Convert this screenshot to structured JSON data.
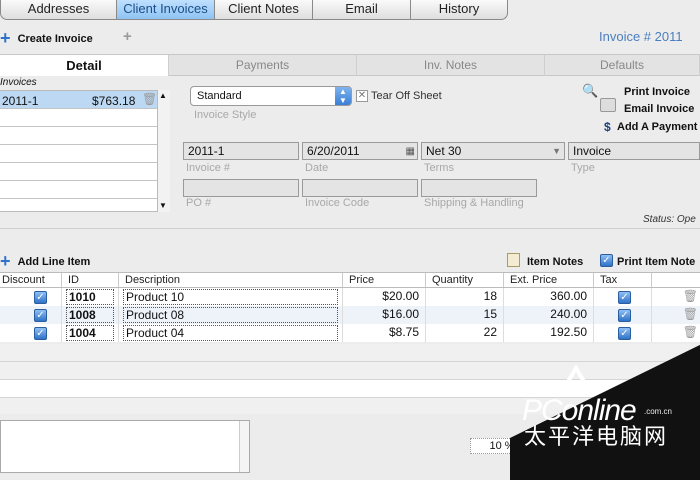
{
  "top_tabs": [
    "Addresses",
    "Client Invoices",
    "Client Notes",
    "Email",
    "History"
  ],
  "toolbar": {
    "create_invoice": "Create Invoice",
    "invoice_number": "Invoice # 2011"
  },
  "sub_tabs": [
    "Detail",
    "Payments",
    "Inv. Notes",
    "Defaults"
  ],
  "invoices_list": {
    "heading": "Invoices",
    "items": [
      {
        "id": "2011-1",
        "amount": "$763.18"
      }
    ]
  },
  "form": {
    "style_value": "Standard",
    "style_label": "Invoice Style",
    "tear_off": "Tear Off Sheet",
    "invoice_no": "2011-1",
    "invoice_no_label": "Invoice #",
    "date": "6/20/2011",
    "date_label": "Date",
    "terms": "Net 30",
    "terms_label": "Terms",
    "type": "Invoice",
    "type_label": "Type",
    "po_label": "PO #",
    "invoice_code_label": "Invoice Code",
    "shipping_label": "Shipping & Handling",
    "status": "Status: Ope"
  },
  "actions": {
    "print": "Print Invoice",
    "email": "Email Invoice",
    "add_payment": "Add A Payment",
    "dollar": "$"
  },
  "line_items": {
    "add_label": "Add Line Item",
    "item_notes": "Item Notes",
    "print_item_notes": "Print Item Note",
    "columns": [
      "Discount",
      "ID",
      "Description",
      "Price",
      "Quantity",
      "Ext. Price",
      "Tax"
    ],
    "rows": [
      {
        "id": "1010",
        "description": "Product 10",
        "price": "$20.00",
        "quantity": "18",
        "ext_price": "360.00"
      },
      {
        "id": "1008",
        "description": "Product 08",
        "price": "$16.00",
        "quantity": "15",
        "ext_price": "240.00"
      },
      {
        "id": "1004",
        "description": "Product 04",
        "price": "$8.75",
        "quantity": "22",
        "ext_price": "192.50"
      }
    ]
  },
  "footer": {
    "percent": "10 %"
  },
  "watermark": {
    "brand": "PConline",
    "domain": ".com.cn",
    "chinese": "太平洋电脑网"
  }
}
